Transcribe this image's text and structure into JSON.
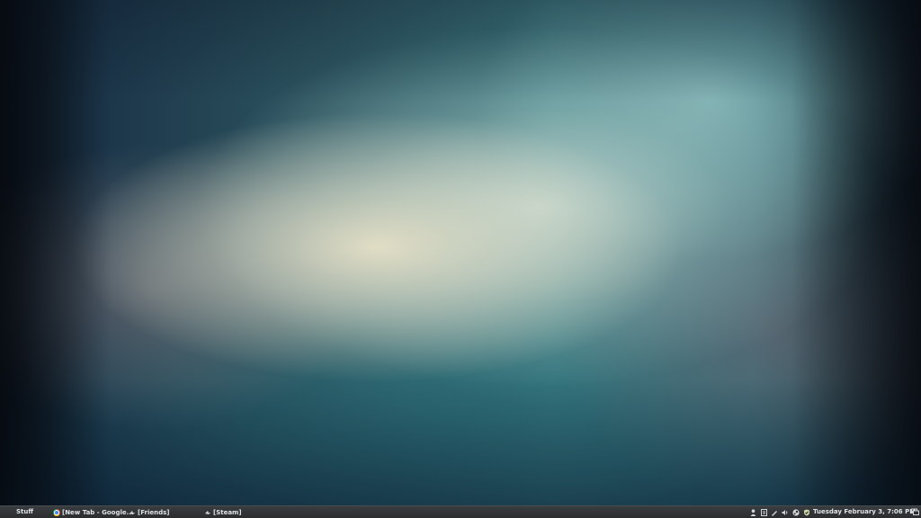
{
  "desktop": {
    "wallpaper": "blurred teal and cream gradient"
  },
  "taskbar": {
    "menu_label": "Stuff",
    "tasks": [
      {
        "label": "[New Tab - Google...",
        "icon": "chrome-icon"
      },
      {
        "label": "[Friends]",
        "icon": "steam-icon"
      },
      {
        "label": "[Steam]",
        "icon": "steam-icon"
      }
    ],
    "tray_icons": [
      "user-icon",
      "clipboard-icon",
      "pen-icon",
      "volume-icon",
      "steam-tray-icon",
      "shield-icon"
    ],
    "clock": "Tuesday February  3,  7:06 PM",
    "notification_icon": "notification-icon"
  },
  "colors": {
    "taskbar": "#2b2d2f",
    "text": "#dfe3e6"
  }
}
